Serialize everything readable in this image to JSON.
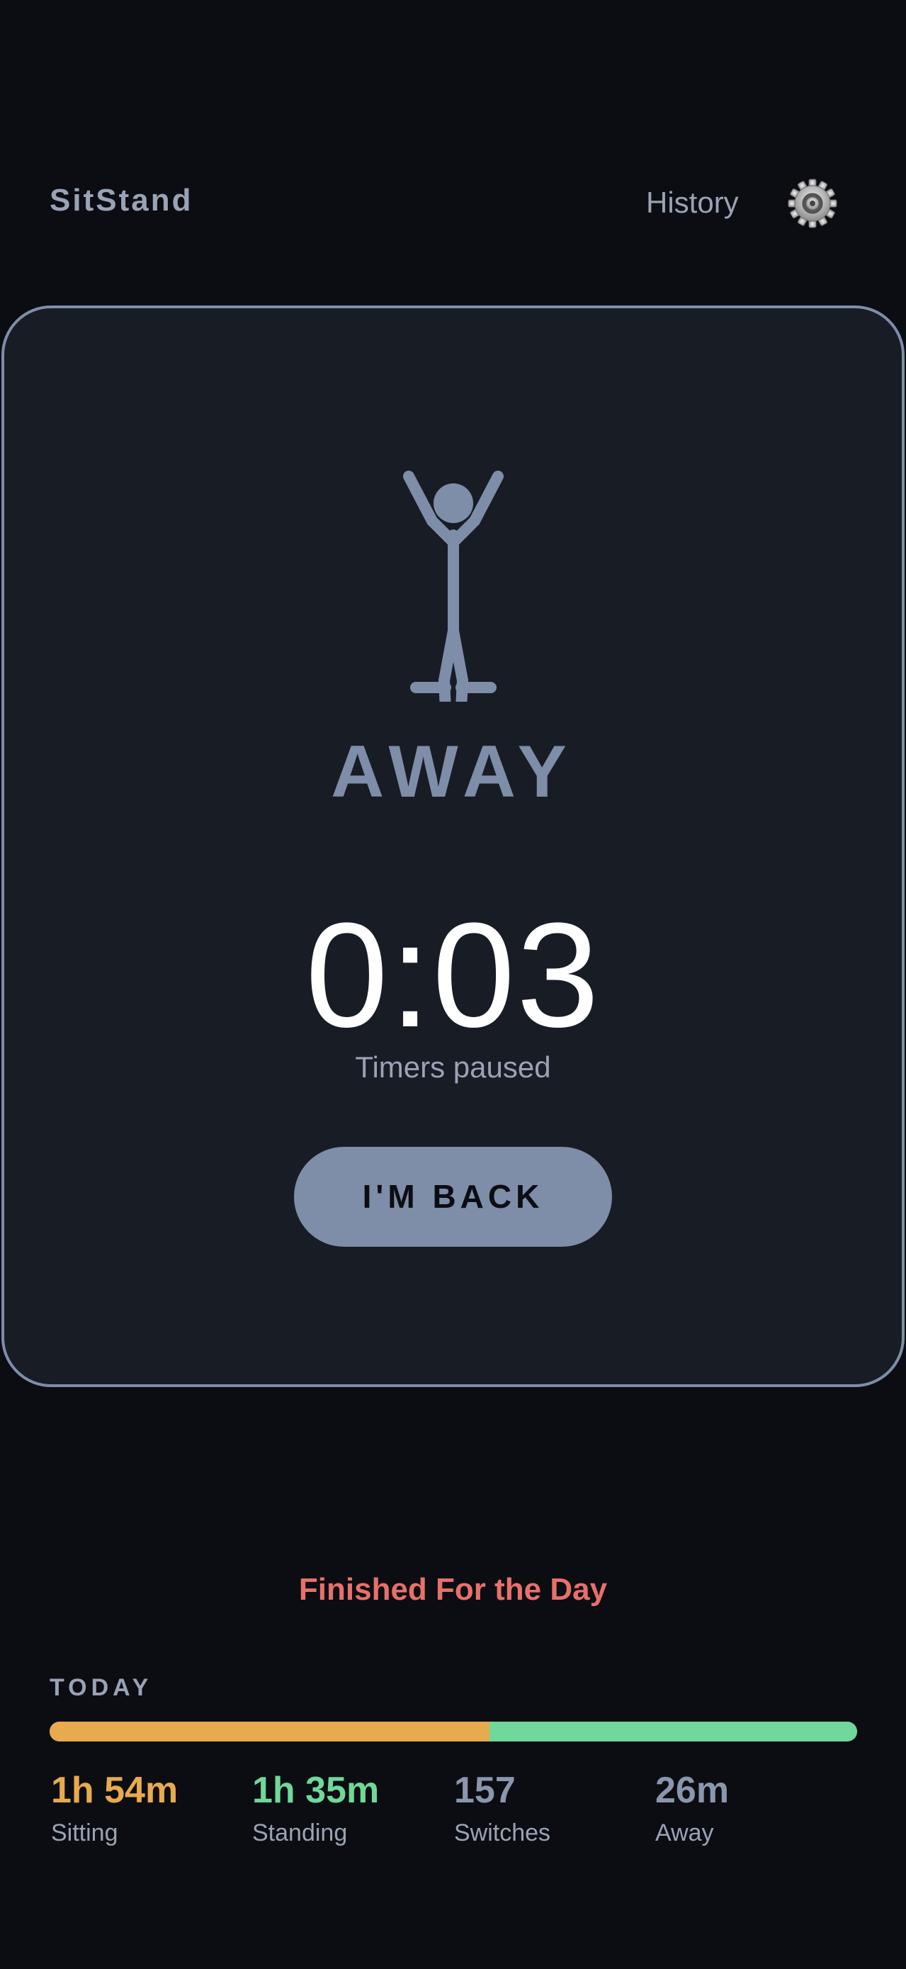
{
  "header": {
    "app_title": "SitStand",
    "history_label": "History",
    "settings_icon": "gear-icon"
  },
  "status_card": {
    "figure_icon": "stick-figure-arms-up-icon",
    "status": "AWAY",
    "timer": "0:03",
    "timer_caption": "Timers paused",
    "back_button_label": "I'M BACK"
  },
  "day_status": "Finished For the Day",
  "today": {
    "label": "TODAY",
    "progress": {
      "sitting_fraction": 0.545,
      "standing_fraction": 0.455
    },
    "stats": [
      {
        "value": "1h 54m",
        "label": "Sitting",
        "color": "#e8aa4e"
      },
      {
        "value": "1h 35m",
        "label": "Standing",
        "color": "#6fd89a"
      },
      {
        "value": "157",
        "label": "Switches",
        "color": "#8a96ad"
      },
      {
        "value": "26m",
        "label": "Away",
        "color": "#8a96ad"
      }
    ]
  },
  "colors": {
    "background": "#0b0d12",
    "card": "#181c25",
    "accent": "#7e8da8",
    "sitting": "#e8aa4e",
    "standing": "#6fd89a",
    "finished": "#e8706a"
  }
}
